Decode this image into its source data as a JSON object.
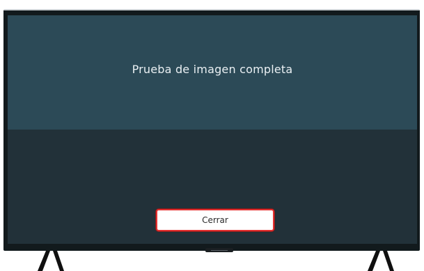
{
  "dialog": {
    "title": "Prueba de imagen completa",
    "close_label": "Cerrar"
  },
  "colors": {
    "screen_top": "#2c4a57",
    "screen_bottom": "#223139",
    "bezel": "#121a1d",
    "button_border": "#e53030"
  }
}
